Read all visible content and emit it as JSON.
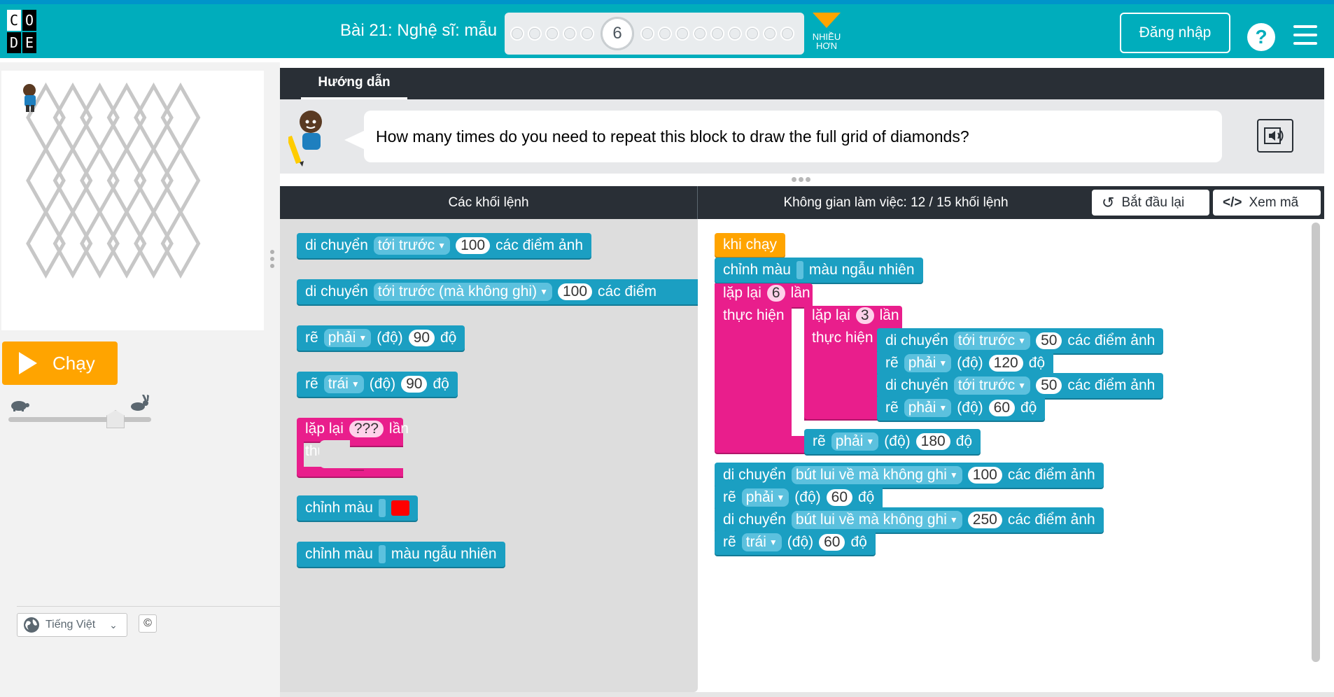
{
  "header": {
    "logo_letters": [
      "C",
      "O",
      "",
      "D",
      "E",
      ""
    ],
    "lesson_title": "Bài 21: Nghệ sĩ: mẫu",
    "current_level": "6",
    "levels_before": 5,
    "levels_after": 9,
    "more_label_1": "NHIỀU",
    "more_label_2": "HƠN",
    "login_label": "Đăng nhập",
    "help_label": "?"
  },
  "left": {
    "run_label": "Chạy",
    "speed_level": 0.75,
    "language_label": "Tiếng Việt",
    "copyright_symbol": "©"
  },
  "instructions": {
    "tab_label": "Hướng dẫn",
    "text": "How many times do you need to repeat this block to draw the full grid of diamonds?"
  },
  "workspace_header": {
    "toolbox_title": "Các khối lệnh",
    "space_title": "Không gian làm việc: 12 / 15 khối lệnh",
    "reset_label": "Bắt đầu lại",
    "code_label": "Xem mã"
  },
  "toolbox": {
    "b1": {
      "verb": "di chuyển",
      "dir": "tới trước",
      "value": "100",
      "unit": "các điểm ảnh"
    },
    "b2": {
      "verb": "di chuyển",
      "dir": "tới trước (mà không ghi)",
      "value": "100",
      "unit": "các điểm"
    },
    "b3": {
      "verb": "rẽ",
      "dir": "phải",
      "paren": "(độ)",
      "value": "90",
      "unit": "độ"
    },
    "b4": {
      "verb": "rẽ",
      "dir": "trái",
      "paren": "(độ)",
      "value": "90",
      "unit": "độ"
    },
    "b5": {
      "repeat": "lặp lại",
      "value": "???",
      "times": "lần",
      "do": "thực hiện"
    },
    "b6": {
      "label": "chỉnh màu",
      "color": "#ff0000"
    },
    "b7": {
      "label": "chỉnh màu",
      "value": "màu ngẫu nhiên"
    }
  },
  "program": {
    "when_run": "khi chạy",
    "set_color": {
      "label": "chỉnh màu",
      "value": "màu ngẫu nhiên"
    },
    "outer_loop": {
      "repeat": "lặp lại",
      "value": "6",
      "times": "lần",
      "do": "thực hiện"
    },
    "inner_loop": {
      "repeat": "lặp lại",
      "value": "3",
      "times": "lần",
      "do": "thực hiện"
    },
    "inner_1": {
      "verb": "di chuyển",
      "dir": "tới trước",
      "value": "50",
      "unit": "các điểm ảnh"
    },
    "inner_2": {
      "verb": "rẽ",
      "dir": "phải",
      "paren": "(độ)",
      "value": "120",
      "unit": "độ"
    },
    "inner_3": {
      "verb": "di chuyển",
      "dir": "tới trước",
      "value": "50",
      "unit": "các điểm ảnh"
    },
    "inner_4": {
      "verb": "rẽ",
      "dir": "phải",
      "paren": "(độ)",
      "value": "60",
      "unit": "độ"
    },
    "outer_turn": {
      "verb": "rẽ",
      "dir": "phải",
      "paren": "(độ)",
      "value": "180",
      "unit": "độ"
    },
    "after_1": {
      "verb": "di chuyển",
      "dir": "bút lui về mà không ghi",
      "value": "100",
      "unit": "các điểm ảnh"
    },
    "after_2": {
      "verb": "rẽ",
      "dir": "phải",
      "paren": "(độ)",
      "value": "60",
      "unit": "độ"
    },
    "after_3": {
      "verb": "di chuyển",
      "dir": "bút lui về mà không ghi",
      "value": "250",
      "unit": "các điểm ảnh"
    },
    "after_4": {
      "verb": "rẽ",
      "dir": "trái",
      "paren": "(độ)",
      "value": "60",
      "unit": "độ"
    }
  },
  "colors": {
    "header": "#00adbc",
    "run_button": "#ffa400",
    "motion_block": "#1b9fc2",
    "loop_block": "#e91e8c",
    "event_block": "#ffa400"
  }
}
